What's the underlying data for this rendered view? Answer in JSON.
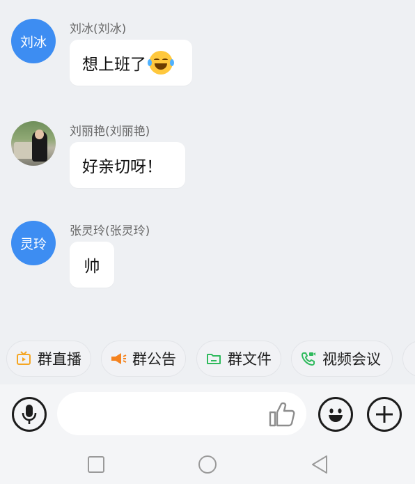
{
  "messages": [
    {
      "sender": "刘冰(刘冰)",
      "avatar_text": "刘冰",
      "text": "想上班了",
      "emoji": "laughing-tears-emoji"
    },
    {
      "sender": "刘丽艳(刘丽艳)",
      "avatar_text": "",
      "text": "好亲切呀！",
      "avatar_type": "photo"
    },
    {
      "sender": "张灵玲(张灵玲)",
      "avatar_text": "灵玲",
      "text": "帅"
    }
  ],
  "quick_actions": [
    {
      "label": "群直播",
      "icon": "live-tv-icon",
      "color": "#f5a623"
    },
    {
      "label": "群公告",
      "icon": "megaphone-icon",
      "color": "#f5831f"
    },
    {
      "label": "群文件",
      "icon": "folder-icon",
      "color": "#2fba5d"
    },
    {
      "label": "视频会议",
      "icon": "video-call-icon",
      "color": "#2fba5d"
    }
  ],
  "input": {
    "placeholder": "",
    "value": ""
  },
  "colors": {
    "avatar_blue": "#3d8df2",
    "background": "#eef0f3"
  }
}
